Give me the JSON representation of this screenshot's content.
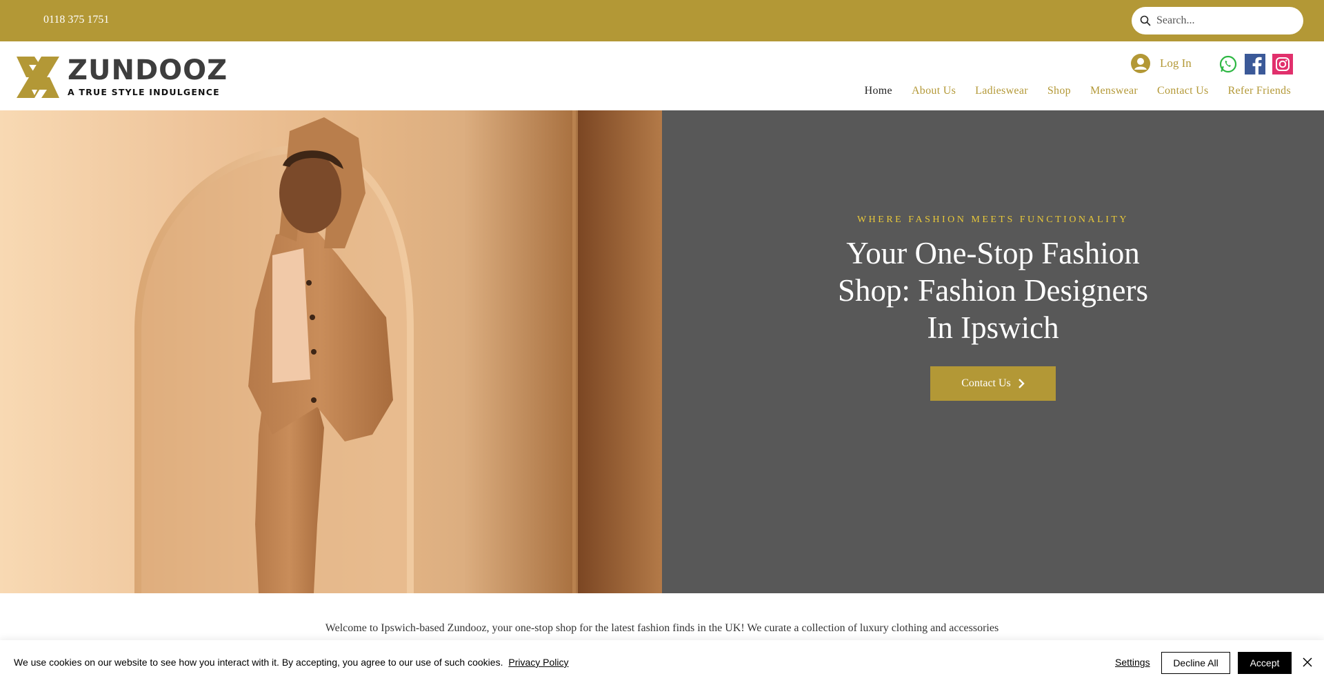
{
  "topbar": {
    "phone": "0118 375 1751",
    "search_placeholder": "Search..."
  },
  "header": {
    "logo_name": "ZUNDOOZ",
    "logo_tagline": "A TRUE STYLE INDULGENCE",
    "login_label": "Log In",
    "social": [
      "whatsapp-icon",
      "facebook-icon",
      "instagram-icon"
    ],
    "nav": [
      {
        "label": "Home",
        "active": true
      },
      {
        "label": "About Us"
      },
      {
        "label": "Ladieswear"
      },
      {
        "label": "Shop"
      },
      {
        "label": "Menswear"
      },
      {
        "label": "Contact Us"
      },
      {
        "label": "Refer Friends"
      }
    ]
  },
  "hero": {
    "eyebrow": "WHERE FASHION MEETS FUNCTIONALITY",
    "headline": "Your One-Stop Fashion Shop: Fashion Designers In Ipswich",
    "cta_label": "Contact Us"
  },
  "welcome": {
    "text": "Welcome to Ipswich-based Zundooz, your one-stop shop for the latest fashion finds in the UK! We curate a collection of luxury clothing and accessories"
  },
  "cookie": {
    "message": "We use cookies on our website to see how you interact with it. By accepting, you agree to our use of such cookies.",
    "policy_link": "Privacy Policy",
    "settings_label": "Settings",
    "decline_label": "Decline All",
    "accept_label": "Accept"
  },
  "colors": {
    "brand_gold": "#b39836",
    "hero_panel": "#585858",
    "eyebrow": "#e8c83a"
  }
}
